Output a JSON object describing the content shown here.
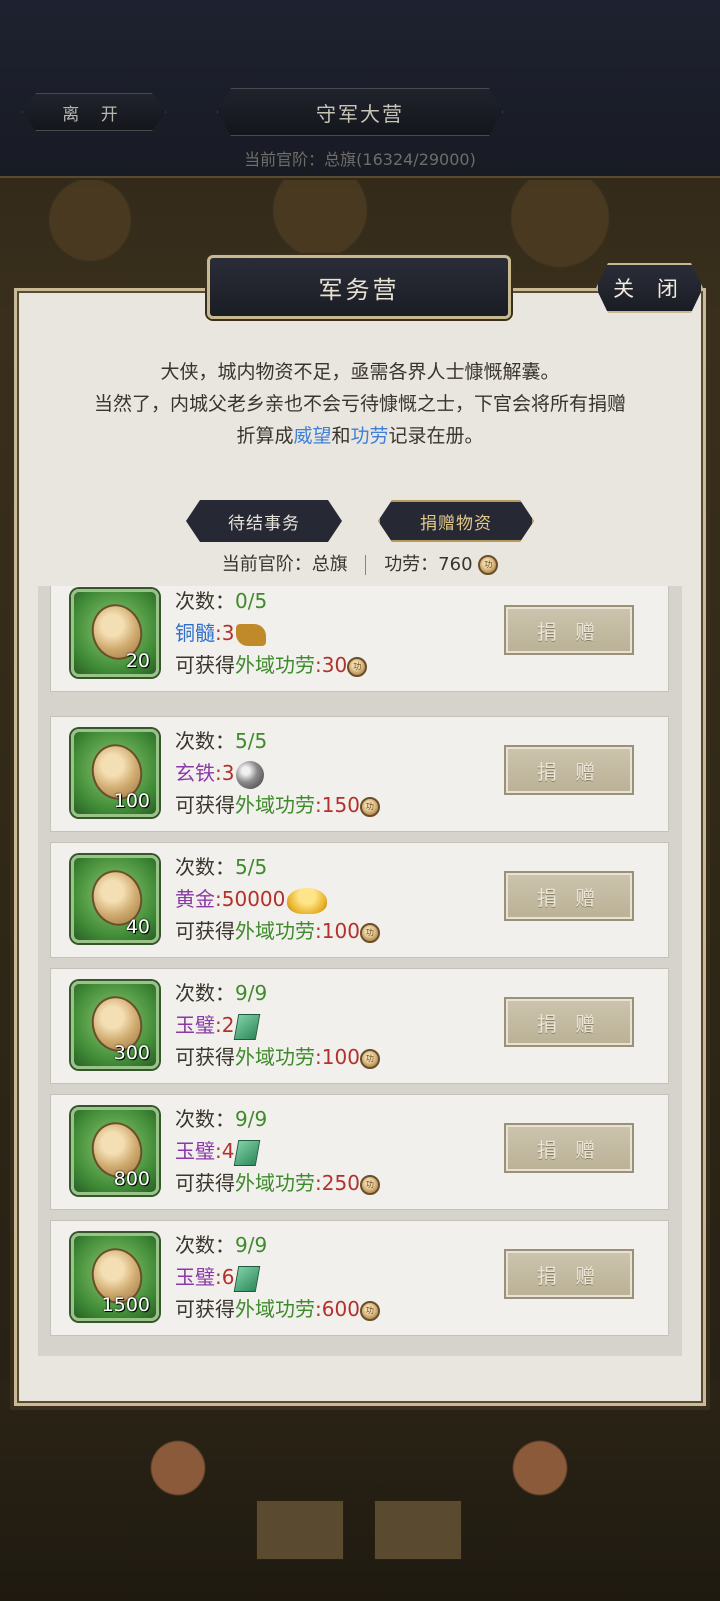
{
  "top": {
    "leave_label": "离 开",
    "title": "守军大营",
    "rank_line": "当前官阶：总旗(16324/29000)"
  },
  "panel": {
    "title": "军务营",
    "close_label": "关 闭",
    "intro_line1": "大侠，城内物资不足，亟需各界人士慷慨解囊。",
    "intro_line2": "当然了，内城父老乡亲也不会亏待慷慨之士，下官会将所有捐赠",
    "intro_line3_pre": "折算成",
    "intro_hl1": "威望",
    "intro_and": "和",
    "intro_hl2": "功劳",
    "intro_line3_post": "记录在册。",
    "tab_pending": "待结事务",
    "tab_donate": "捐赠物资",
    "status_rank": "当前官阶：总旗",
    "status_merit": "功劳：760",
    "coin_glyph": "功"
  },
  "items": [
    {
      "qty": "20",
      "times_label": "次数：",
      "times": "0/5",
      "res_name": "铜髓",
      "res_count": ":3",
      "res_color": "blue",
      "res_icon": "copper-icon",
      "reward_pre": "可获得",
      "reward_name": "外域功劳",
      "reward_val": ":30",
      "btn": "捐 赠"
    },
    {
      "qty": "100",
      "times_label": "次数：",
      "times": "5/5",
      "res_name": "玄铁",
      "res_count": ":3",
      "res_color": "purple",
      "res_icon": "iron-ball-icon",
      "reward_pre": "可获得",
      "reward_name": "外域功劳",
      "reward_val": ":150",
      "btn": "捐 赠"
    },
    {
      "qty": "40",
      "times_label": "次数：",
      "times": "5/5",
      "res_name": "黄金",
      "res_count": ":50000",
      "res_color": "purple",
      "res_icon": "gold-ingot-icon",
      "reward_pre": "可获得",
      "reward_name": "外域功劳",
      "reward_val": ":100",
      "btn": "捐 赠"
    },
    {
      "qty": "300",
      "times_label": "次数：",
      "times": "9/9",
      "res_name": "玉璧",
      "res_count": ":2",
      "res_color": "purple",
      "res_icon": "jade-icon",
      "reward_pre": "可获得",
      "reward_name": "外域功劳",
      "reward_val": ":100",
      "btn": "捐 赠"
    },
    {
      "qty": "800",
      "times_label": "次数：",
      "times": "9/9",
      "res_name": "玉璧",
      "res_count": ":4",
      "res_color": "purple",
      "res_icon": "jade-icon",
      "reward_pre": "可获得",
      "reward_name": "外域功劳",
      "reward_val": ":250",
      "btn": "捐 赠"
    },
    {
      "qty": "1500",
      "times_label": "次数：",
      "times": "9/9",
      "res_name": "玉璧",
      "res_count": ":6",
      "res_color": "purple",
      "res_icon": "jade-icon",
      "reward_pre": "可获得",
      "reward_name": "外域功劳",
      "reward_val": ":600",
      "btn": "捐 赠"
    }
  ]
}
